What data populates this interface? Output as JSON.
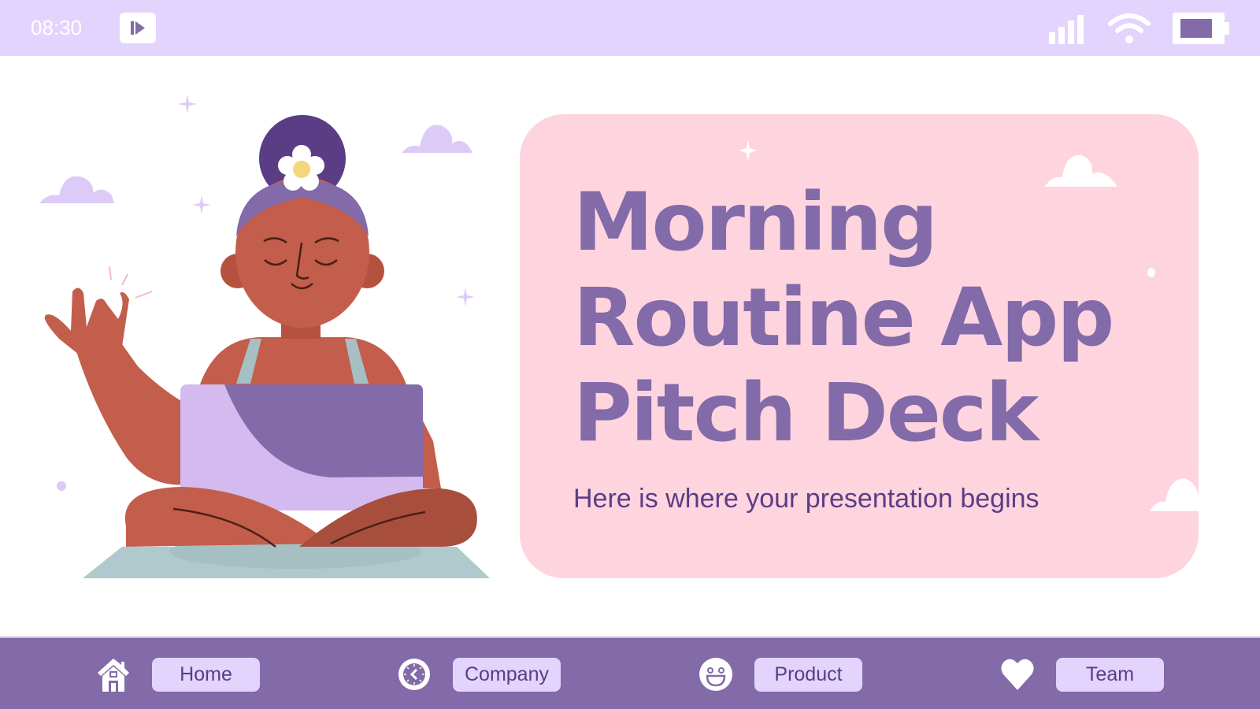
{
  "status_bar": {
    "time": "08:30",
    "play_button": "play-icon",
    "icons": [
      "signal-icon",
      "wifi-icon",
      "battery-icon"
    ]
  },
  "hero": {
    "title_lines": [
      "Morning",
      "Routine App",
      "Pitch Deck"
    ],
    "subtitle": "Here is where your presentation begins"
  },
  "nav": {
    "items": [
      {
        "label": "Home",
        "icon": "home-icon"
      },
      {
        "label": "Company",
        "icon": "clock-icon"
      },
      {
        "label": "Product",
        "icon": "smiley-icon"
      },
      {
        "label": "Team",
        "icon": "heart-icon"
      }
    ]
  },
  "colors": {
    "status_bar_bg": "#e2d4fc",
    "accent_purple": "#836aa8",
    "dark_purple": "#5b3d85",
    "card_pink": "#fed4df",
    "nav_button_bg": "#e2d4fc"
  }
}
